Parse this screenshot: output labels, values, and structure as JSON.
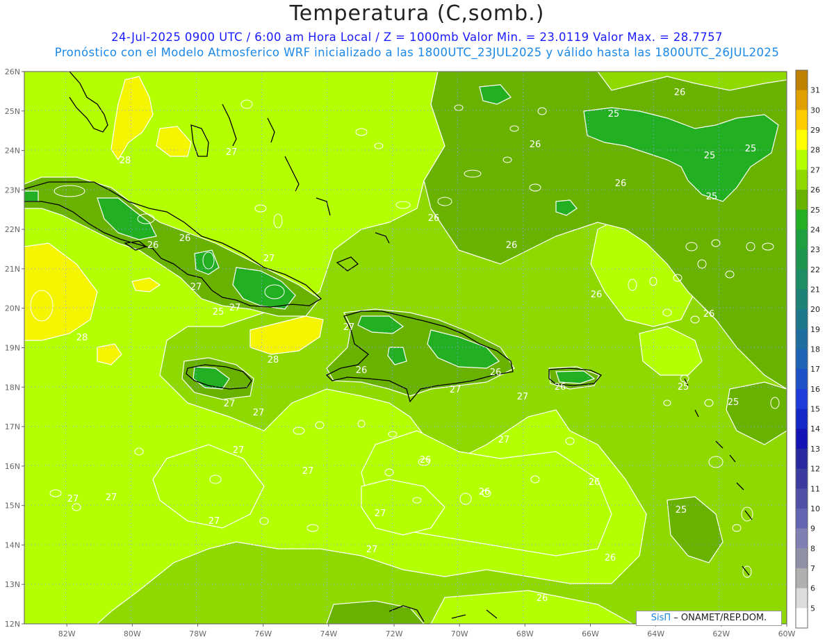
{
  "header": {
    "title": "Temperatura (C,somb.)",
    "subtitle1": "24-Jul-2025  0900 UTC / 6:00 am Hora Local / Z = 1000mb    Valor Min. = 23.0119  Valor Max. = 28.7757",
    "subtitle2": "Pronóstico con el Modelo Atmosferico WRF inicializado a las 1800UTC_23JUL2025 y válido hasta las  1800UTC_26JUL2025"
  },
  "map": {
    "lat_labels": [
      "26N",
      "25N",
      "24N",
      "23N",
      "22N",
      "21N",
      "20N",
      "19N",
      "18N",
      "17N",
      "16N",
      "15N",
      "14N",
      "13N",
      "12N"
    ],
    "lon_labels": [
      "82W",
      "80W",
      "78W",
      "76W",
      "74W",
      "72W",
      "70W",
      "68W",
      "66W",
      "64W",
      "62W",
      "60W"
    ],
    "lat_range": [
      12,
      26
    ],
    "lon_range": [
      -83.3,
      -60
    ],
    "grid": true,
    "colors": {
      "c28": "#f5f500",
      "c27": "#b4ff00",
      "c26": "#8fd800",
      "c25": "#6ab200",
      "c24": "#22b022",
      "coast": "#000000",
      "contour": "#ffffff"
    },
    "contour_labels": [
      "28",
      "28",
      "28",
      "27",
      "27",
      "27",
      "27",
      "27",
      "27",
      "27",
      "27",
      "27",
      "27",
      "27",
      "27",
      "27",
      "27",
      "27",
      "27",
      "27",
      "26",
      "26",
      "26",
      "26",
      "26",
      "26",
      "26",
      "26",
      "26",
      "26",
      "26",
      "26",
      "26",
      "26",
      "26",
      "26",
      "26",
      "25",
      "25",
      "25",
      "25",
      "25",
      "25",
      "25",
      "25"
    ]
  },
  "colorbar": {
    "labels": [
      "31",
      "30",
      "29",
      "28",
      "27",
      "26",
      "25",
      "24",
      "23",
      "22",
      "21",
      "20",
      "19",
      "18",
      "17",
      "16",
      "15",
      "14",
      "13",
      "12",
      "11",
      "10",
      "9",
      "8",
      "7",
      "6",
      "5"
    ],
    "colors": [
      "#c08000",
      "#e0a000",
      "#ffcc00",
      "#ffff00",
      "#b4ff00",
      "#8fd800",
      "#6ab200",
      "#22b022",
      "#1fa040",
      "#1e9650",
      "#1e8c64",
      "#1e8278",
      "#1e788c",
      "#1e6ea0",
      "#1e64b4",
      "#1e50c8",
      "#1e3cdc",
      "#1428c8",
      "#1414b4",
      "#2828a0",
      "#3c3ca0",
      "#5050a8",
      "#6464b4",
      "#8080b4",
      "#9090a8",
      "#b0b0b0",
      "#dcdcdc",
      "#ffffff"
    ]
  },
  "credit": {
    "brand": "SisΠ",
    "text": "– ONAMET/REP.DOM."
  }
}
